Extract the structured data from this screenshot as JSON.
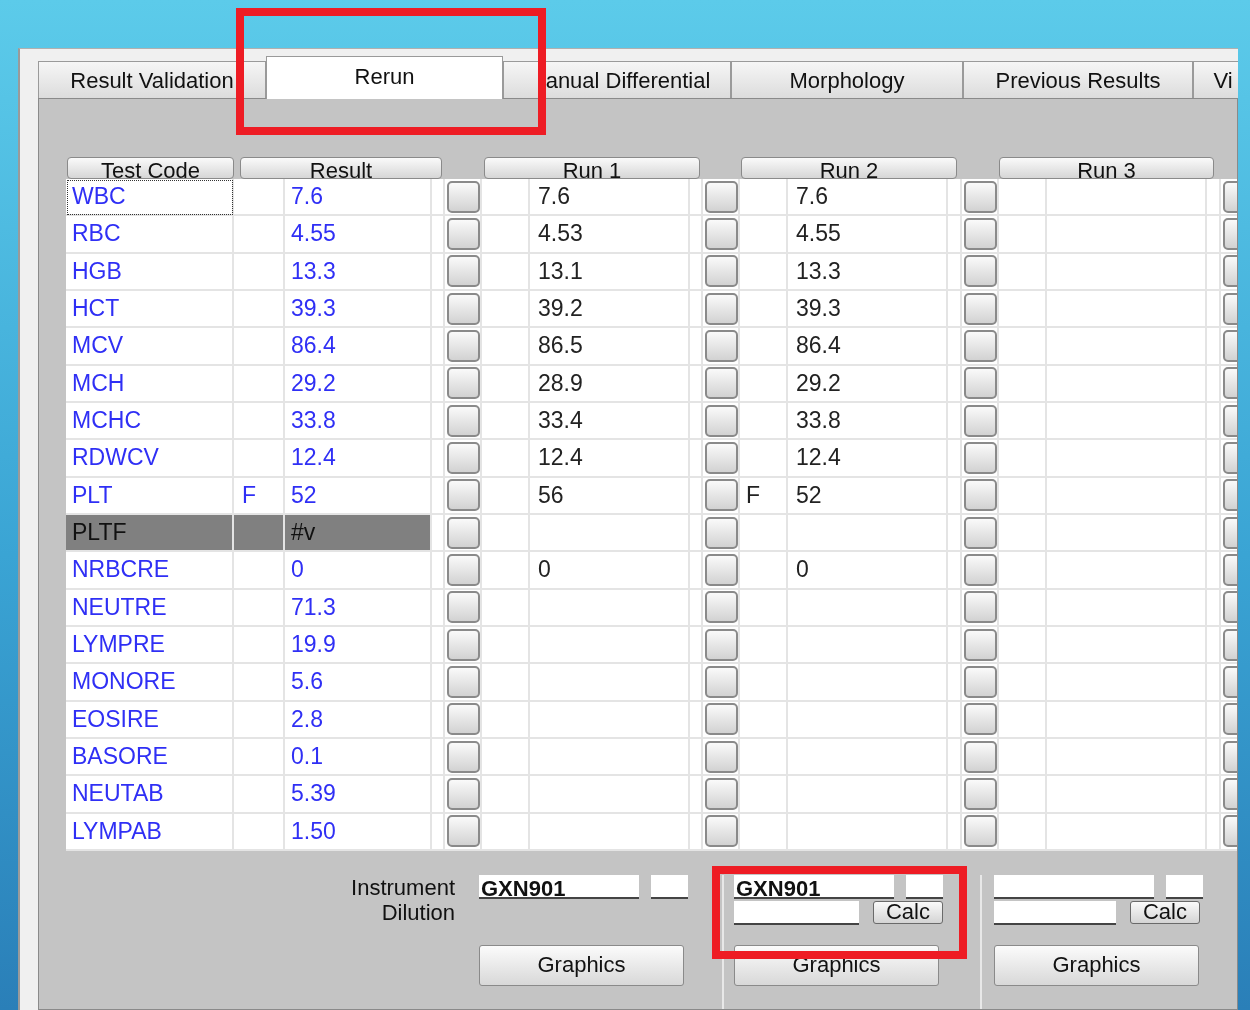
{
  "tabs": [
    {
      "label": "Result Validation",
      "selected": false
    },
    {
      "label": "Rerun",
      "selected": true
    },
    {
      "label": "anual Differential",
      "selected": false
    },
    {
      "label": "Morphology",
      "selected": false
    },
    {
      "label": "Previous Results",
      "selected": false
    },
    {
      "label": "Vi",
      "selected": false
    }
  ],
  "table": {
    "columns": [
      "Test Code",
      "Result",
      "Run 1",
      "Run 2",
      "Run 3"
    ],
    "rows": [
      {
        "code": "WBC",
        "result": "7.6",
        "focused": true,
        "highlighted": false,
        "runs": [
          {
            "value": "7.6"
          },
          {
            "value": "7.6"
          }
        ]
      },
      {
        "code": "RBC",
        "result": "4.55",
        "focused": false,
        "highlighted": false,
        "runs": [
          {
            "value": "4.53"
          },
          {
            "value": "4.55"
          }
        ]
      },
      {
        "code": "HGB",
        "result": "13.3",
        "focused": false,
        "highlighted": false,
        "runs": [
          {
            "value": "13.1"
          },
          {
            "value": "13.3"
          }
        ]
      },
      {
        "code": "HCT",
        "result": "39.3",
        "focused": false,
        "highlighted": false,
        "runs": [
          {
            "value": "39.2"
          },
          {
            "value": "39.3"
          }
        ]
      },
      {
        "code": "MCV",
        "result": "86.4",
        "focused": false,
        "highlighted": false,
        "runs": [
          {
            "value": "86.5"
          },
          {
            "value": "86.4"
          }
        ]
      },
      {
        "code": "MCH",
        "result": "29.2",
        "focused": false,
        "highlighted": false,
        "runs": [
          {
            "value": "28.9"
          },
          {
            "value": "29.2"
          }
        ]
      },
      {
        "code": "MCHC",
        "result": "33.8",
        "focused": false,
        "highlighted": false,
        "runs": [
          {
            "value": "33.4"
          },
          {
            "value": "33.8"
          }
        ]
      },
      {
        "code": "RDWCV",
        "result": "12.4",
        "focused": false,
        "highlighted": false,
        "runs": [
          {
            "value": "12.4"
          },
          {
            "value": "12.4"
          }
        ]
      },
      {
        "code": "PLT",
        "flag": "F",
        "result": "52",
        "focused": false,
        "highlighted": false,
        "runs": [
          {
            "value": "56"
          },
          {
            "flag": "F",
            "value": "52"
          }
        ]
      },
      {
        "code": "PLTF",
        "result": "#v",
        "focused": false,
        "highlighted": true
      },
      {
        "code": "NRBCRE",
        "result": "0",
        "focused": false,
        "highlighted": false,
        "runs": [
          {
            "value": "0"
          },
          {
            "value": "0"
          }
        ]
      },
      {
        "code": "NEUTRE",
        "result": "71.3",
        "focused": false,
        "highlighted": false
      },
      {
        "code": "LYMPRE",
        "result": "19.9",
        "focused": false,
        "highlighted": false
      },
      {
        "code": "MONORE",
        "result": "5.6",
        "focused": false,
        "highlighted": false
      },
      {
        "code": "EOSIRE",
        "result": "2.8",
        "focused": false,
        "highlighted": false
      },
      {
        "code": "BASORE",
        "result": "0.1",
        "focused": false,
        "highlighted": false
      },
      {
        "code": "NEUTAB",
        "result": "5.39",
        "focused": false,
        "highlighted": false
      },
      {
        "code": "LYMPAB",
        "result": "1.50",
        "focused": false,
        "highlighted": false
      }
    ]
  },
  "bottom": {
    "instrument_label": "Instrument",
    "dilution_label": "Dilution",
    "runs": [
      {
        "instrument": "GXN901",
        "graphics": "Graphics"
      },
      {
        "instrument": "GXN901",
        "calc": "Calc",
        "graphics": "Graphics"
      },
      {
        "calc": "Calc",
        "graphics": "Graphics"
      }
    ]
  }
}
